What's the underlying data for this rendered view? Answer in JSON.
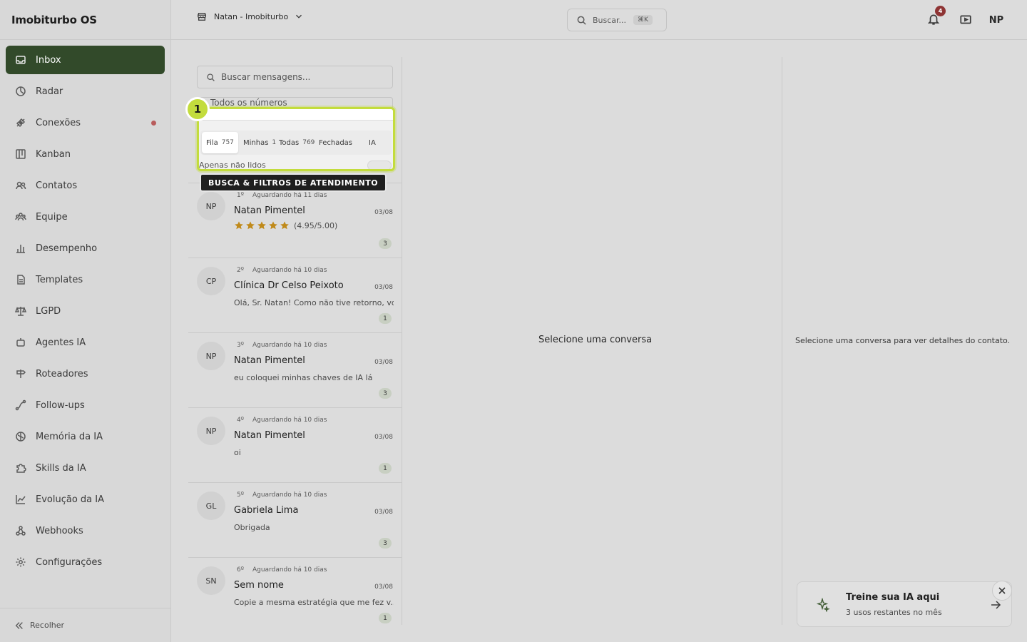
{
  "app": {
    "title": "Imobiturbo OS"
  },
  "sidebar": {
    "items": [
      {
        "label": "Inbox",
        "icon": "inbox-icon",
        "active": true
      },
      {
        "label": "Radar",
        "icon": "radar-icon"
      },
      {
        "label": "Conexões",
        "icon": "plug-icon",
        "notify": true
      },
      {
        "label": "Kanban",
        "icon": "kanban-icon"
      },
      {
        "label": "Contatos",
        "icon": "contacts-icon"
      },
      {
        "label": "Equipe",
        "icon": "team-icon"
      },
      {
        "label": "Desempenho",
        "icon": "bar-chart-icon"
      },
      {
        "label": "Templates",
        "icon": "document-icon"
      },
      {
        "label": "LGPD",
        "icon": "scale-icon"
      },
      {
        "label": "Agentes IA",
        "icon": "bot-icon"
      },
      {
        "label": "Roteadores",
        "icon": "signpost-icon"
      },
      {
        "label": "Follow-ups",
        "icon": "route-icon"
      },
      {
        "label": "Memória da IA",
        "icon": "brain-icon"
      },
      {
        "label": "Skills da IA",
        "icon": "puzzle-icon"
      },
      {
        "label": "Evolução da IA",
        "icon": "trend-icon"
      },
      {
        "label": "Webhooks",
        "icon": "webhook-icon"
      },
      {
        "label": "Configurações",
        "icon": "gear-icon"
      }
    ],
    "collapse_label": "Recolher"
  },
  "topbar": {
    "workspace": "Natan - Imobiturbo",
    "search_placeholder": "Buscar...",
    "search_shortcut": "⌘K",
    "notifications_count": "4",
    "user_initials": "NP"
  },
  "inbox": {
    "search_placeholder": "Buscar mensagens...",
    "number_filter": "Todos os números",
    "tabs": [
      {
        "label": "Fila",
        "count": "757",
        "active": true
      },
      {
        "label": "Minhas",
        "count": "1"
      },
      {
        "label": "Todas",
        "count": "769"
      },
      {
        "label": "Fechadas",
        "count": ""
      },
      {
        "label": "IA",
        "count": ""
      }
    ],
    "only_unread_label": "Apenas não lidos",
    "conversations": [
      {
        "initials": "NP",
        "position": "1º",
        "waiting": "Aguardando há 11 dias",
        "name": "Natan Pimentel",
        "date": "03/08",
        "preview": "",
        "rating": "(4.95/5.00)",
        "rating_value": 4.95,
        "unread": "3"
      },
      {
        "initials": "CP",
        "position": "2º",
        "waiting": "Aguardando há 10 dias",
        "name": "Clínica Dr Celso Peixoto",
        "date": "03/08",
        "preview": "Olá, Sr. Natan! Como não tive retorno, vo...",
        "unread": "1"
      },
      {
        "initials": "NP",
        "position": "3º",
        "waiting": "Aguardando há 10 dias",
        "name": "Natan Pimentel",
        "date": "03/08",
        "preview": "eu coloquei minhas chaves de IA lá",
        "unread": "3"
      },
      {
        "initials": "NP",
        "position": "4º",
        "waiting": "Aguardando há 10 dias",
        "name": "Natan Pimentel",
        "date": "03/08",
        "preview": "oi",
        "unread": "1"
      },
      {
        "initials": "GL",
        "position": "5º",
        "waiting": "Aguardando há 10 dias",
        "name": "Gabriela Lima",
        "date": "03/08",
        "preview": "Obrigada",
        "unread": "3"
      },
      {
        "initials": "SN",
        "position": "6º",
        "waiting": "Aguardando há 10 dias",
        "name": "Sem nome",
        "date": "03/08",
        "preview": "Copie a mesma estratégia que me fez v...",
        "unread": "1"
      }
    ]
  },
  "tour": {
    "step": "1",
    "label": "BUSCA & FILTROS DE ATENDIMENTO",
    "highlight_color": "#c3dc3d"
  },
  "main": {
    "empty_message": "Selecione uma conversa"
  },
  "details": {
    "empty_message": "Selecione uma conversa para ver detalhes do contato."
  },
  "promo": {
    "title": "Treine sua IA aqui",
    "subtitle": "3 usos restantes no mês"
  },
  "colors": {
    "accent": "#324a2a",
    "badge": "#8e3434",
    "star": "#c08a1a"
  }
}
